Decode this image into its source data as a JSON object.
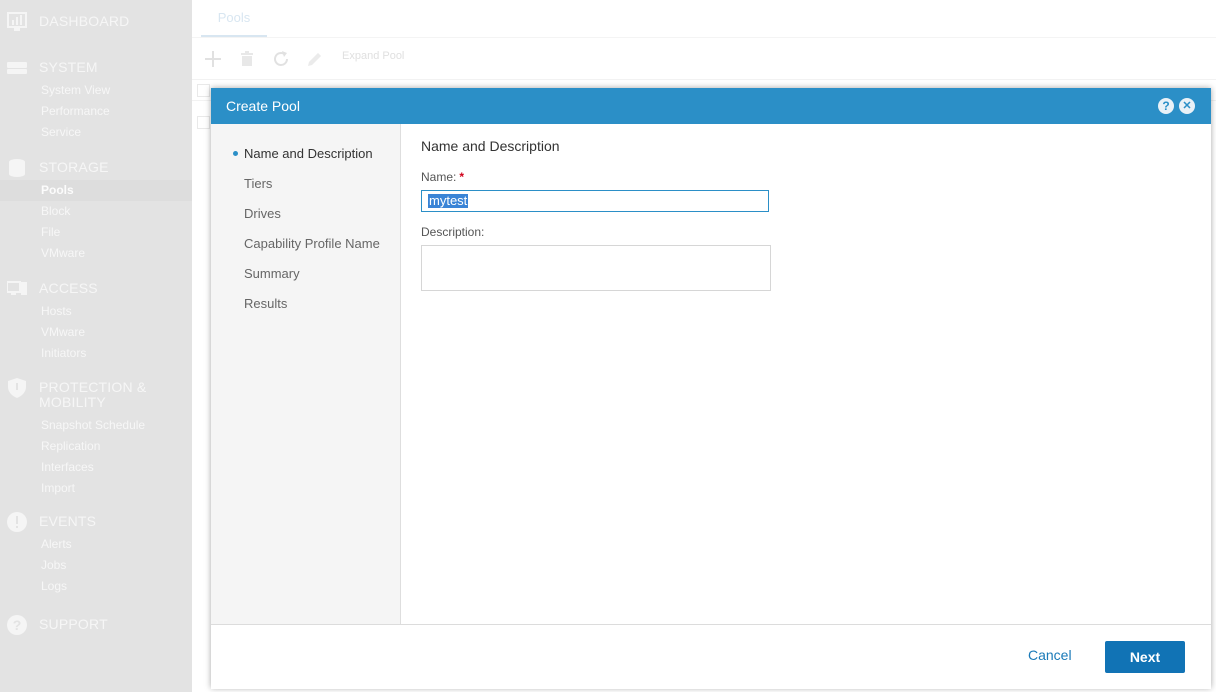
{
  "sidebar": {
    "sections": [
      {
        "title": "DASHBOARD",
        "icon": "dashboard-icon",
        "items": []
      },
      {
        "title": "SYSTEM",
        "icon": "server-icon",
        "items": [
          "System View",
          "Performance",
          "Service"
        ]
      },
      {
        "title": "STORAGE",
        "icon": "database-icon",
        "items": [
          "Pools",
          "Block",
          "File",
          "VMware"
        ],
        "active_item": "Pools"
      },
      {
        "title": "ACCESS",
        "icon": "hosts-icon",
        "items": [
          "Hosts",
          "VMware",
          "Initiators"
        ]
      },
      {
        "title": "PROTECTION & MOBILITY",
        "title_line1": "PROTECTION &",
        "title_line2": "MOBILITY",
        "icon": "shield-icon",
        "items": [
          "Snapshot Schedule",
          "Replication",
          "Interfaces",
          "Import"
        ]
      },
      {
        "title": "EVENTS",
        "icon": "alert-icon",
        "items": [
          "Alerts",
          "Jobs",
          "Logs"
        ]
      },
      {
        "title": "SUPPORT",
        "icon": "help-icon",
        "items": []
      }
    ]
  },
  "main": {
    "tab": "Pools",
    "toolbar": {
      "add_icon": "plus-icon",
      "delete_icon": "trash-icon",
      "refresh_icon": "refresh-icon",
      "edit_icon": "pencil-icon",
      "expand_label": "Expand Pool"
    }
  },
  "dialog": {
    "title": "Create Pool",
    "help_label": "?",
    "close_label": "✕",
    "steps": [
      "Name and Description",
      "Tiers",
      "Drives",
      "Capability Profile Name",
      "Summary",
      "Results"
    ],
    "active_step": "Name and Description",
    "section_title": "Name and Description",
    "name_label": "Name:",
    "required_mark": "*",
    "name_value": "mytest",
    "description_label": "Description:",
    "description_value": "",
    "cancel_label": "Cancel",
    "next_label": "Next"
  },
  "colors": {
    "accent": "#2b8fc7",
    "primary_button": "#1173b5",
    "sidebar_bg": "#d4d4d4",
    "required": "#d0021b"
  }
}
